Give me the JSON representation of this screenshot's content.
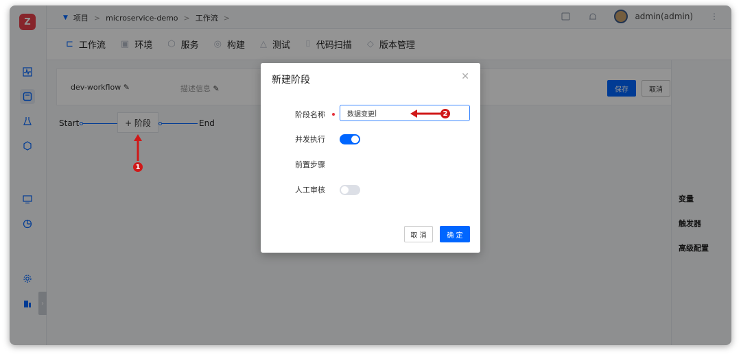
{
  "breadcrumb": {
    "root": "项目",
    "project": "microservice-demo",
    "current": "工作流"
  },
  "user": {
    "name": "admin(admin)"
  },
  "tabs": [
    {
      "label": "工作流",
      "icon": "workflow-icon"
    },
    {
      "label": "环境",
      "icon": "environment-icon"
    },
    {
      "label": "服务",
      "icon": "service-icon"
    },
    {
      "label": "构建",
      "icon": "build-icon"
    },
    {
      "label": "测试",
      "icon": "test-icon"
    },
    {
      "label": "代码扫描",
      "icon": "code-scan-icon"
    },
    {
      "label": "版本管理",
      "icon": "version-icon"
    }
  ],
  "workflow": {
    "name": "dev-workflow",
    "description_placeholder": "描述信息",
    "save_label": "保存",
    "cancel_label": "取消"
  },
  "pipeline": {
    "start": "Start",
    "add_stage": "+ 阶段",
    "end": "End"
  },
  "right_panel": {
    "items": [
      "变量",
      "触发器",
      "高级配置"
    ]
  },
  "modal": {
    "title": "新建阶段",
    "stage_name_label": "阶段名称",
    "stage_name_value": "数据变更",
    "parallel_label": "并发执行",
    "parallel_on": true,
    "pre_step_label": "前置步骤",
    "manual_review_label": "人工审核",
    "manual_review_on": false,
    "cancel_label": "取 消",
    "ok_label": "确 定"
  },
  "annotations": {
    "first": "1",
    "second": "2"
  },
  "colors": {
    "accent": "#0066ff",
    "annotation": "#d01818",
    "logo": "#e8404a"
  }
}
